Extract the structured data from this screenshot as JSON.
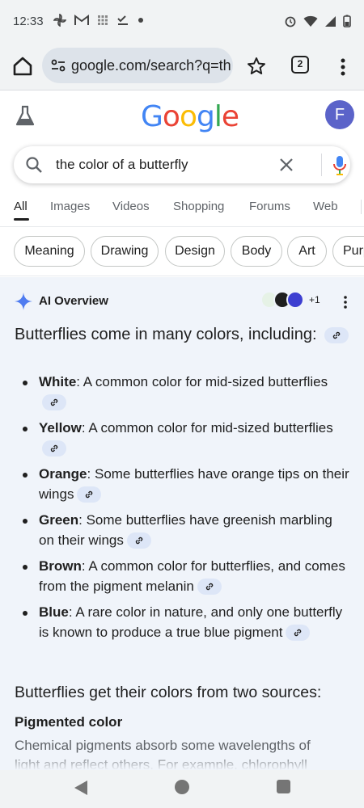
{
  "status_bar": {
    "time": "12:33",
    "notification_icons": [
      "pinwheel-icon",
      "gmail-icon",
      "grid-icon",
      "checklist-icon",
      "dot-icon"
    ],
    "system_icons": [
      "alarm-icon",
      "wifi-icon",
      "signal-icon",
      "battery-icon"
    ]
  },
  "browser": {
    "url": "google.com/search?q=th",
    "tab_count": "2"
  },
  "google": {
    "logo_letters": [
      "G",
      "o",
      "o",
      "g",
      "l",
      "e"
    ],
    "logo_colors": [
      "#4285F4",
      "#EA4335",
      "#FBBC05",
      "#4285F4",
      "#34A853",
      "#EA4335"
    ],
    "avatar_letter": "F",
    "avatar_color": "#5b63c9"
  },
  "search": {
    "query": "the color of a butterfly"
  },
  "tabs": [
    {
      "label": "All",
      "active": true
    },
    {
      "label": "Images"
    },
    {
      "label": "Videos"
    },
    {
      "label": "Shopping"
    },
    {
      "label": "Forums"
    },
    {
      "label": "Web"
    }
  ],
  "chips": [
    "Meaning",
    "Drawing",
    "Design",
    "Body",
    "Art",
    "Purp"
  ],
  "ai_overview": {
    "title": "AI Overview",
    "sources_more": "+1",
    "lead": "Butterflies come in many colors, including:",
    "items": [
      {
        "term": "White",
        "text": ": A common color for mid-sized butterflies"
      },
      {
        "term": "Yellow",
        "text": ": A common color for mid-sized butterflies"
      },
      {
        "term": "Orange",
        "text": ": Some butterflies have orange tips on their wings"
      },
      {
        "term": "Green",
        "text": ": Some butterflies have greenish marbling on their wings"
      },
      {
        "term": "Brown",
        "text": ": A common color for butterflies, and comes from the pigment melanin"
      },
      {
        "term": "Blue",
        "text": ": A rare color in nature, and only one butterfly is known to produce a true blue pigment"
      }
    ],
    "section_heading": "Butterflies get their colors from two sources:",
    "subheading": "Pigmented color",
    "paragraph": "Chemical pigments absorb some wavelengths of light and reflect others. For example, chlorophyll"
  }
}
